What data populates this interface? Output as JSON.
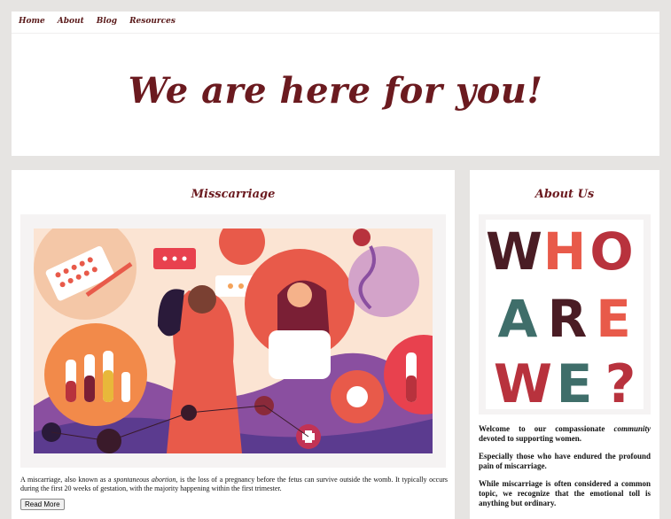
{
  "nav": {
    "items": [
      "Home",
      "About",
      "Blog",
      "Resources"
    ]
  },
  "hero": {
    "title": "We are here for you!"
  },
  "main": {
    "title": "Misscarriage",
    "para_before": "A miscarriage, also known as a ",
    "para_em": "spontaneous abortion,",
    "para_after": " is the loss of a pregnancy before the fetus can survive outside the womb. It typically occurs during the first 20 weeks of gestation, with the majority happening within the first trimester.",
    "read_more": "Read More"
  },
  "side": {
    "title": "About Us",
    "poster_words": [
      "WHO",
      "ARE",
      "WE?"
    ],
    "p1_before": "Welcome to our compassionate ",
    "p1_em": "community",
    "p1_after": " devoted to supporting women.",
    "p2": "Especially those who have endured the profound pain of miscarriage.",
    "p3": "While miscarriage is often considered a common topic, we recognize that the emotional toll is anything but ordinary."
  },
  "colors": {
    "brand": "#6b1a1f",
    "background": "#e6e4e2",
    "coral": "#e85a4a",
    "purple": "#6d4a9a",
    "teal": "#3f6e6a",
    "dark_maroon": "#4a1c24"
  }
}
